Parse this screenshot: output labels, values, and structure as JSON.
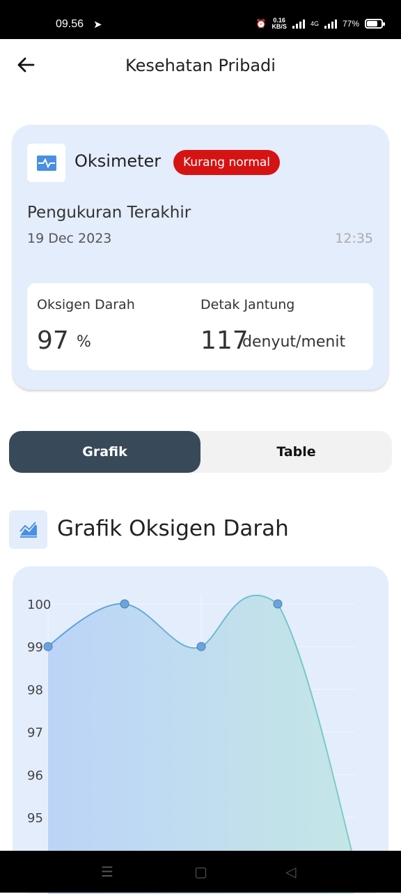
{
  "status_bar": {
    "time": "09.56",
    "net_speed_value": "0.16",
    "net_speed_unit": "KB/S",
    "network_type": "4G",
    "battery": "77%",
    "battery_level": 0.77
  },
  "header": {
    "title": "Kesehatan Pribadi"
  },
  "card": {
    "title": "Oksimeter",
    "badge": "Kurang normal",
    "badge_color": "#d61313",
    "subtitle": "Pengukuran Terakhir",
    "date": "19 Dec 2023",
    "time": "12:35",
    "oxygen": {
      "label": "Oksigen Darah",
      "value": "97",
      "unit": "%"
    },
    "heart": {
      "label": "Detak Jantung",
      "value": "117",
      "unit": "denyut/menit"
    }
  },
  "tabs": {
    "active": "Grafik",
    "inactive": "Table"
  },
  "section": {
    "title": "Grafik Oksigen Darah"
  },
  "chart_data": {
    "type": "area",
    "title": "",
    "ylim": [
      94,
      101
    ],
    "y_ticks": [
      "100",
      "99",
      "98",
      "97",
      "96",
      "95"
    ],
    "points": [
      99,
      100,
      99,
      100
    ],
    "grid": true,
    "colors": {
      "line_start": "#5aa0d8",
      "line_end": "#7ccfc8",
      "point": "#6aa3de",
      "area": "#bcd4f5"
    }
  }
}
